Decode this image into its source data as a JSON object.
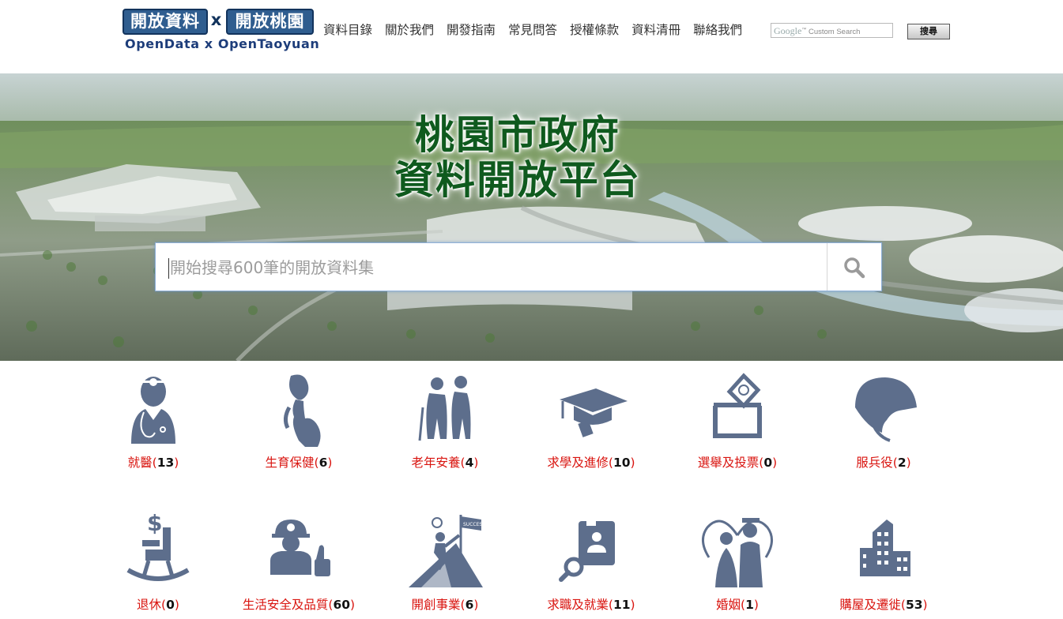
{
  "logo": {
    "left": "開放資料",
    "x": "x",
    "right": "開放桃園",
    "subtitle": "OpenData x OpenTaoyuan"
  },
  "nav": [
    "資料目錄",
    "關於我們",
    "開發指南",
    "常見問答",
    "授權條款",
    "資料清冊",
    "聯絡我們"
  ],
  "google_search": {
    "brand": "Google",
    "placeholder": "Custom Search",
    "button": "搜尋"
  },
  "banner": {
    "title_line1": "桃園市政府",
    "title_line2": "資料開放平台",
    "search_placeholder": "開始搜尋600筆的開放資料集"
  },
  "categories": [
    {
      "name": "就醫",
      "count": "13",
      "icon": "doctor-icon"
    },
    {
      "name": "生育保健",
      "count": "6",
      "icon": "pregnant-woman-icon"
    },
    {
      "name": "老年安養",
      "count": "4",
      "icon": "elderly-couple-icon"
    },
    {
      "name": "求學及進修",
      "count": "10",
      "icon": "graduation-icon"
    },
    {
      "name": "選舉及投票",
      "count": "0",
      "icon": "ballot-box-icon"
    },
    {
      "name": "服兵役",
      "count": "2",
      "icon": "military-helmet-icon"
    },
    {
      "name": "退休",
      "count": "0",
      "icon": "rocking-chair-icon"
    },
    {
      "name": "生活安全及品質",
      "count": "60",
      "icon": "worker-thumbs-up-icon"
    },
    {
      "name": "開創事業",
      "count": "6",
      "icon": "success-climber-icon"
    },
    {
      "name": "求職及就業",
      "count": "11",
      "icon": "job-search-icon"
    },
    {
      "name": "婚姻",
      "count": "1",
      "icon": "couple-heart-icon"
    },
    {
      "name": "購屋及遷徙",
      "count": "53",
      "icon": "buildings-icon"
    }
  ]
}
